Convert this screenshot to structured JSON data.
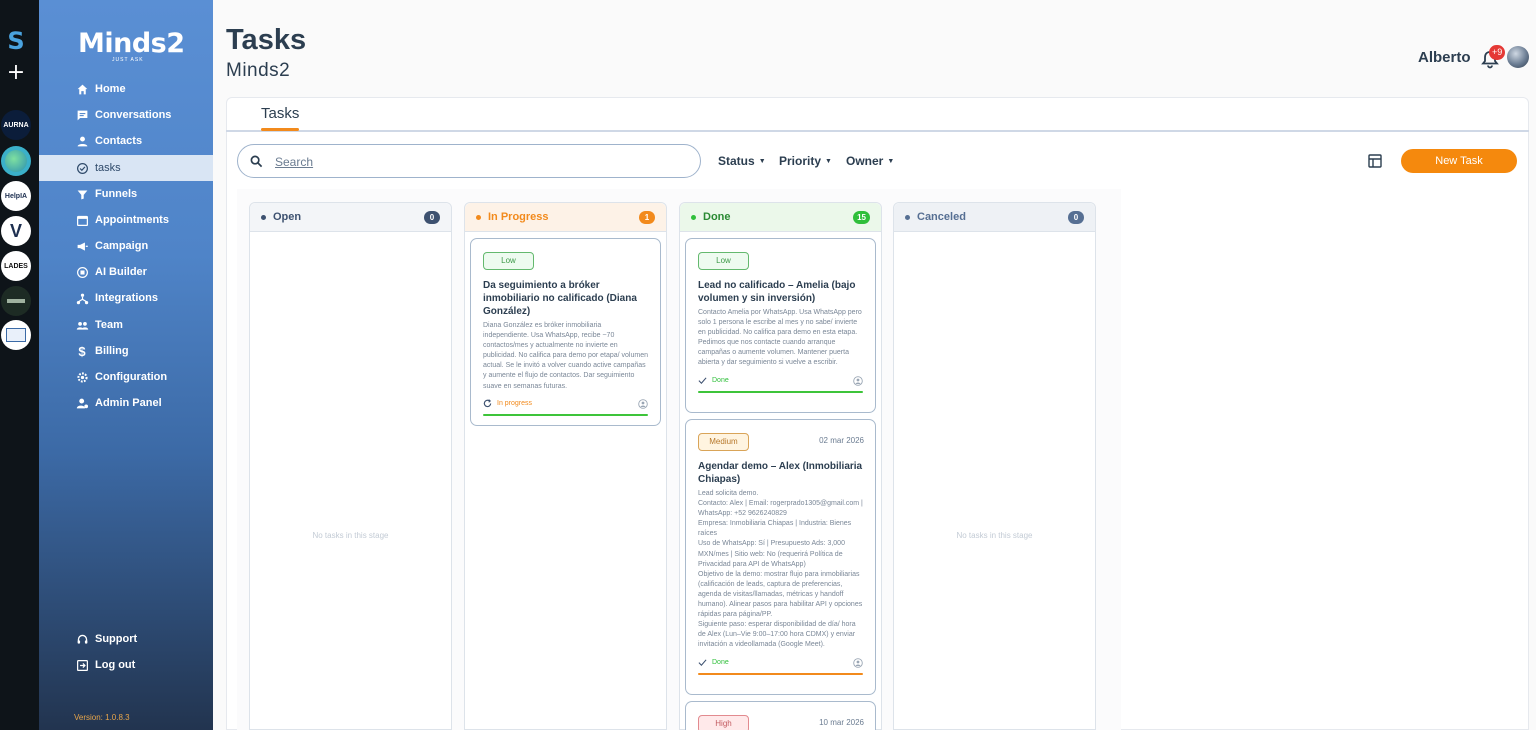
{
  "rail": {
    "logo": "S",
    "workspaces": [
      {
        "label": "AURNA",
        "bg": "#0b1d3a",
        "fg": "#ffffff"
      },
      {
        "label": "",
        "bg": "#3bb0c9",
        "fg": "#ffffff"
      },
      {
        "label": "HelpIA",
        "bg": "#ffffff",
        "fg": "#1d2f50"
      },
      {
        "label": "V",
        "bg": "#ffffff",
        "fg": "#1d2f50"
      },
      {
        "label": "LADES",
        "bg": "#ffffff",
        "fg": "#111111"
      },
      {
        "label": "",
        "bg": "#1d2b24",
        "fg": "#cfd8cf"
      },
      {
        "label": "",
        "bg": "#ffffff",
        "fg": "#1d2f50"
      }
    ]
  },
  "brand": {
    "name": "Minds2",
    "tagline": "JUST ASK"
  },
  "sidebar": {
    "items": [
      {
        "label": "Home",
        "icon": "home-icon"
      },
      {
        "label": "Conversations",
        "icon": "chat-icon"
      },
      {
        "label": "Contacts",
        "icon": "person-icon"
      },
      {
        "label": "tasks",
        "icon": "check-circle-icon"
      },
      {
        "label": "Funnels",
        "icon": "funnel-icon"
      },
      {
        "label": "Appointments",
        "icon": "calendar-icon"
      },
      {
        "label": "Campaign",
        "icon": "megaphone-icon"
      },
      {
        "label": "AI Builder",
        "icon": "chip-icon"
      },
      {
        "label": "Integrations",
        "icon": "network-icon"
      },
      {
        "label": "Team",
        "icon": "team-icon"
      },
      {
        "label": "Billing",
        "icon": "dollar-icon"
      },
      {
        "label": "Configuration",
        "icon": "gear-icon"
      },
      {
        "label": "Admin Panel",
        "icon": "admin-icon"
      }
    ],
    "bottom": [
      {
        "label": "Support",
        "icon": "headset-icon"
      },
      {
        "label": "Log out",
        "icon": "logout-icon"
      }
    ],
    "version": "Version: 1.0.8.3"
  },
  "header": {
    "title": "Tasks",
    "subtitle": "Minds2",
    "user": "Alberto",
    "notifications": "+9"
  },
  "tabs": {
    "active": "Tasks"
  },
  "toolbar": {
    "search_placeholder": "Search",
    "filters": {
      "status": "Status",
      "priority": "Priority",
      "owner": "Owner"
    },
    "new_task": "New Task"
  },
  "colors": {
    "accent": "#f5890d",
    "open": "#3d5170",
    "progress": "#f28a1c",
    "done": "#2fbf3a",
    "canceled": "#566f93"
  },
  "columns": {
    "open": {
      "name": "Open",
      "count": "0",
      "empty": "No tasks in this stage"
    },
    "progress": {
      "name": "In Progress",
      "count": "1",
      "cards": [
        {
          "priority": "Low",
          "title": "Da seguimiento a bróker inmobiliario no calificado (Diana González)",
          "desc": "Diana González es bróker inmobiliaria independiente. Usa WhatsApp, recibe ~70 contactos/mes y actualmente no invierte en publicidad. No califica para demo por etapa/ volumen actual. Se le invitó a volver cuando active campañas y aumente el flujo de contactos. Dar seguimiento suave en semanas futuras.",
          "status": "In progress"
        }
      ]
    },
    "done": {
      "name": "Done",
      "count": "15",
      "cards": [
        {
          "priority": "Low",
          "title": "Lead no calificado – Amelia (bajo volumen y sin inversión)",
          "desc": "Contacto Amelia por WhatsApp. Usa WhatsApp pero solo 1 persona le escribe al mes y no sabe/ invierte en publicidad. No califica para demo en esta etapa. Pedimos que nos contacte cuando arranque campañas o aumente volumen. Mantener puerta abierta y dar seguimiento si vuelve a escribir.",
          "status": "Done"
        },
        {
          "priority": "Medium",
          "date": "02 mar 2026",
          "title": "Agendar demo – Alex (Inmobiliaria Chiapas)",
          "desc": "Lead solicita demo.\nContacto: Alex | Email: rogerprado1305@gmail.com | WhatsApp: +52 9626240829\nEmpresa: Inmobiliaria Chiapas | Industria: Bienes raíces\nUso de WhatsApp: Sí | Presupuesto Ads: 3,000 MXN/mes | Sitio web: No (requerirá Política de Privacidad para API de WhatsApp)\nObjetivo de la demo: mostrar flujo para inmobiliarias (calificación de leads, captura de preferencias, agenda de visitas/llamadas, métricas y handoff humano). Alinear pasos para habilitar API y opciones rápidas para página/PP.\nSiguiente paso: esperar disponibilidad de día/ hora de Alex (Lun–Vie 9:00–17:00 hora CDMX) y enviar invitación a videollamada (Google Meet).",
          "status": "Done"
        },
        {
          "priority": "High",
          "date": "10 mar 2026"
        }
      ]
    },
    "canceled": {
      "name": "Canceled",
      "count": "0",
      "empty": "No tasks in this stage"
    }
  }
}
